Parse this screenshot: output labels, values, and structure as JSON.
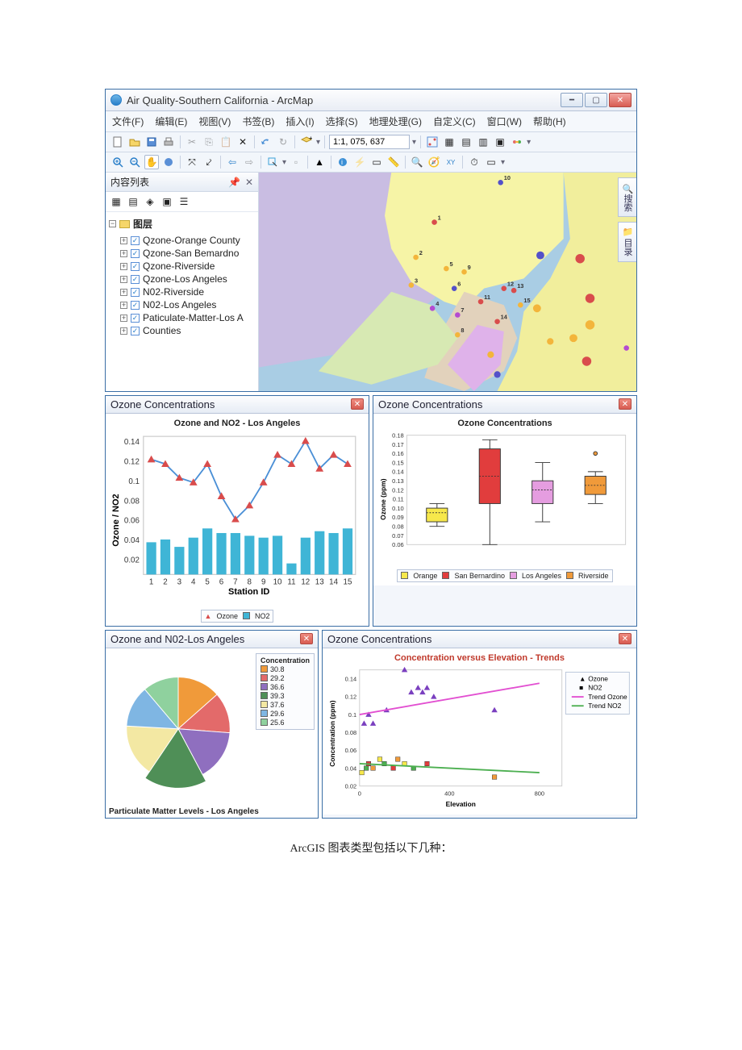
{
  "window": {
    "title": "Air Quality-Southern California - ArcMap"
  },
  "menubar": [
    "文件(F)",
    "编辑(E)",
    "视图(V)",
    "书签(B)",
    "插入(I)",
    "选择(S)",
    "地理处理(G)",
    "自定义(C)",
    "窗口(W)",
    "帮助(H)"
  ],
  "scale": "1:1, 075, 637",
  "toc": {
    "title": "内容列表",
    "root": "图层",
    "items": [
      "Qzone-Orange County",
      "Qzone-San Bemardno",
      "Qzone-Riverside",
      "Qzone-Los Angeles",
      "N02-Riverside",
      "N02-Los Angeles",
      "Paticulate-Matter-Los A",
      "Counties"
    ]
  },
  "sidetabs": [
    "搜索",
    "目录"
  ],
  "map_points_labeled": [
    {
      "id": "1",
      "x": 265,
      "y": 75,
      "c": "#d94c4c"
    },
    {
      "id": "2",
      "x": 237,
      "y": 128,
      "c": "#f3b53b"
    },
    {
      "id": "3",
      "x": 230,
      "y": 170,
      "c": "#f3b53b"
    },
    {
      "id": "5",
      "x": 283,
      "y": 145,
      "c": "#f3b53b"
    },
    {
      "id": "9",
      "x": 310,
      "y": 150,
      "c": "#f3b53b"
    },
    {
      "id": "6",
      "x": 295,
      "y": 175,
      "c": "#5451c9"
    },
    {
      "id": "4",
      "x": 262,
      "y": 205,
      "c": "#b44bd1"
    },
    {
      "id": "7",
      "x": 300,
      "y": 215,
      "c": "#b44bd1"
    },
    {
      "id": "11",
      "x": 335,
      "y": 195,
      "c": "#d94c4c"
    },
    {
      "id": "12",
      "x": 370,
      "y": 175,
      "c": "#d94c4c"
    },
    {
      "id": "13",
      "x": 385,
      "y": 178,
      "c": "#d94c4c"
    },
    {
      "id": "15",
      "x": 395,
      "y": 200,
      "c": "#f3b53b"
    },
    {
      "id": "14",
      "x": 360,
      "y": 225,
      "c": "#d94c4c"
    },
    {
      "id": "8",
      "x": 300,
      "y": 245,
      "c": "#f3b53b"
    },
    {
      "id": "10",
      "x": 365,
      "y": 15,
      "c": "#5451c9"
    }
  ],
  "map_points_unlabeled": [
    {
      "x": 350,
      "y": 275,
      "c": "#f3b53b",
      "r": 5
    },
    {
      "x": 360,
      "y": 305,
      "c": "#5451c9",
      "r": 5
    },
    {
      "x": 420,
      "y": 205,
      "c": "#f3b53b",
      "r": 6
    },
    {
      "x": 425,
      "y": 125,
      "c": "#5451c9",
      "r": 6
    },
    {
      "x": 485,
      "y": 130,
      "c": "#d94c4c",
      "r": 7
    },
    {
      "x": 500,
      "y": 190,
      "c": "#d94c4c",
      "r": 7
    },
    {
      "x": 495,
      "y": 285,
      "c": "#d94c4c",
      "r": 7
    },
    {
      "x": 500,
      "y": 230,
      "c": "#f3b53b",
      "r": 7
    },
    {
      "x": 475,
      "y": 250,
      "c": "#f3b53b",
      "r": 6
    },
    {
      "x": 440,
      "y": 255,
      "c": "#f3b53b",
      "r": 5
    },
    {
      "x": 555,
      "y": 265,
      "c": "#b44bd1",
      "r": 4
    }
  ],
  "panels": {
    "line": {
      "title": "Ozone Concentrations",
      "chart_title": "Ozone and NO2 - Los Angeles",
      "xlabel": "Station ID",
      "ylabel": "Ozone / NO2",
      "legend": [
        "Ozone",
        "NO2"
      ]
    },
    "box": {
      "title": "Ozone Concentrations",
      "chart_title": "Ozone Concentrations",
      "ylabel": "Ozone (ppm)",
      "legend": [
        "Orange",
        "San Bernardino",
        "Los Angeles",
        "Riverside"
      ]
    },
    "pie": {
      "title": "Ozone and N02-Los Angeles",
      "legend_title": "Concentration",
      "footer": "Particulate Matter Levels - Los Angeles"
    },
    "scatter": {
      "title": "Ozone Concentrations",
      "chart_title": "Concentration versus Elevation - Trends",
      "xlabel": "Elevation",
      "ylabel": "Concentration (ppm)",
      "legend": [
        "Ozone",
        "NO2",
        "Trend Ozone",
        "Trend NO2"
      ]
    }
  },
  "caption": "ArcGIS 图表类型包括以下几种：",
  "chart_data": [
    {
      "type": "line",
      "title": "Ozone and NO2 - Los Angeles",
      "xlabel": "Station ID",
      "ylabel": "Ozone / NO2",
      "x": [
        1,
        2,
        3,
        4,
        5,
        6,
        7,
        8,
        9,
        10,
        11,
        12,
        13,
        14,
        15
      ],
      "series": [
        {
          "name": "Ozone",
          "values": [
            0.125,
            0.12,
            0.105,
            0.1,
            0.12,
            0.085,
            0.06,
            0.075,
            0.1,
            0.13,
            0.12,
            0.145,
            0.115,
            0.13,
            0.12
          ]
        },
        {
          "name": "NO2",
          "values": [
            0.035,
            0.038,
            0.03,
            0.04,
            0.05,
            0.045,
            0.045,
            0.042,
            0.04,
            0.042,
            0.012,
            0.04,
            0.047,
            0.045,
            0.05
          ]
        }
      ],
      "ylim": [
        0,
        0.15
      ]
    },
    {
      "type": "boxplot",
      "title": "Ozone Concentrations",
      "ylabel": "Ozone (ppm)",
      "categories": [
        "Orange",
        "San Bernardino",
        "Los Angeles",
        "Riverside"
      ],
      "boxes": [
        {
          "min": 0.08,
          "q1": 0.085,
          "median": 0.095,
          "q3": 0.1,
          "max": 0.105,
          "color": "#f7e84b"
        },
        {
          "min": 0.06,
          "q1": 0.105,
          "median": 0.135,
          "q3": 0.165,
          "max": 0.175,
          "color": "#e13d3d"
        },
        {
          "min": 0.085,
          "q1": 0.105,
          "median": 0.12,
          "q3": 0.13,
          "max": 0.15,
          "color": "#e59de0"
        },
        {
          "min": 0.105,
          "q1": 0.115,
          "median": 0.125,
          "q3": 0.135,
          "max": 0.14,
          "outliers": [
            0.16
          ],
          "color": "#f09a3a"
        }
      ],
      "ylim": [
        0.06,
        0.18
      ]
    },
    {
      "type": "pie",
      "title": "Particulate Matter Levels - Los Angeles",
      "slices": [
        {
          "label": "30.8",
          "color": "#f09a3a"
        },
        {
          "label": "29.2",
          "color": "#e36a6a"
        },
        {
          "label": "36.6",
          "color": "#8f6fbf"
        },
        {
          "label": "39.3",
          "color": "#4f8f57"
        },
        {
          "label": "37.6",
          "color": "#f3e8a3"
        },
        {
          "label": "29.6",
          "color": "#7fb6e3"
        },
        {
          "label": "25.6",
          "color": "#8fd19e"
        }
      ]
    },
    {
      "type": "scatter",
      "title": "Concentration versus Elevation - Trends",
      "xlabel": "Elevation",
      "ylabel": "Concentration (ppm)",
      "xlim": [
        0,
        900
      ],
      "ylim": [
        0.02,
        0.15
      ],
      "series": [
        {
          "name": "Ozone",
          "marker": "triangle",
          "color": "#7a3fbf",
          "points": [
            [
              20,
              0.09
            ],
            [
              40,
              0.1
            ],
            [
              60,
              0.09
            ],
            [
              120,
              0.105
            ],
            [
              200,
              0.15
            ],
            [
              230,
              0.125
            ],
            [
              260,
              0.13
            ],
            [
              280,
              0.125
            ],
            [
              300,
              0.13
            ],
            [
              330,
              0.12
            ],
            [
              600,
              0.105
            ]
          ]
        },
        {
          "name": "NO2",
          "marker": "square",
          "color_mixed": true,
          "points": [
            [
              10,
              0.035
            ],
            [
              30,
              0.04
            ],
            [
              40,
              0.045
            ],
            [
              60,
              0.04
            ],
            [
              90,
              0.05
            ],
            [
              110,
              0.045
            ],
            [
              150,
              0.04
            ],
            [
              170,
              0.05
            ],
            [
              200,
              0.045
            ],
            [
              240,
              0.04
            ],
            [
              300,
              0.045
            ],
            [
              600,
              0.03
            ]
          ]
        },
        {
          "name": "Trend Ozone",
          "type": "line",
          "color": "#e24fd1",
          "points": [
            [
              0,
              0.1
            ],
            [
              800,
              0.135
            ]
          ]
        },
        {
          "name": "Trend NO2",
          "type": "line",
          "color": "#4caf50",
          "points": [
            [
              0,
              0.045
            ],
            [
              800,
              0.035
            ]
          ]
        }
      ]
    }
  ]
}
